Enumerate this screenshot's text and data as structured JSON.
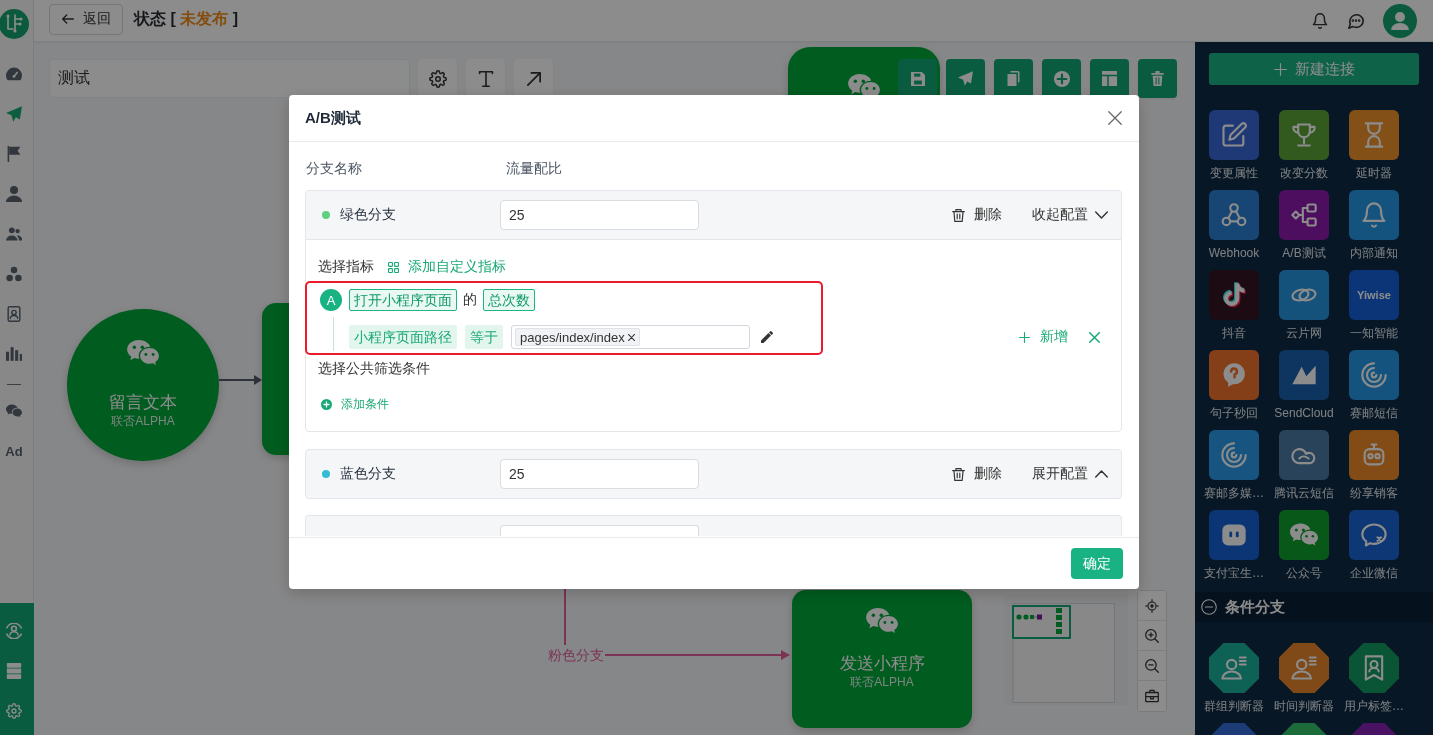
{
  "nav": {
    "main": [
      {
        "selected": false
      },
      {
        "selected": true
      },
      {
        "selected": false
      },
      {
        "selected": false
      },
      {
        "selected": false
      },
      {
        "selected": false
      },
      {
        "selected": false
      },
      {
        "selected": false
      }
    ],
    "extra": [
      {
        "kind": "icon",
        "selected": false
      },
      {
        "kind": "text",
        "label": "Ad",
        "selected": false
      }
    ]
  },
  "top_bar": {
    "back_button": "返回",
    "status": {
      "label": "状态",
      "open": "[",
      "value": "未发布",
      "close": "]"
    }
  },
  "canvas": {
    "flow_name": "测试",
    "nodes": [
      {
        "kind": "rect"
      },
      {
        "kind": "circle",
        "title": "留言文本",
        "subtitle": "联否ALPHA"
      },
      {
        "kind": "rect"
      },
      {
        "kind": "rect",
        "title": "发送小程序",
        "subtitle": "联否ALPHA"
      }
    ],
    "edges": [
      {
        "color": "#2e323b"
      },
      {
        "color": "#7b3555",
        "label": "粉色分支"
      }
    ]
  },
  "modal": {
    "title": "A/B测试",
    "columns": [
      "分支名称",
      "流量配比"
    ],
    "branches": [
      {
        "name": "绿色分支",
        "color": "#5fd07f",
        "ratio": "25",
        "delete_label": "删除",
        "toggle_label": "收起配置",
        "expanded": true,
        "metric_label": "选择指标",
        "add_metric": "添加自定义指标",
        "metric": {
          "highlighted": true,
          "badge": "A",
          "event": "打开小程序页面",
          "joiner": "的",
          "measure": "总次数",
          "filter": {
            "field": "小程序页面路径",
            "operator": "等于",
            "values": [
              "pages/index/index"
            ]
          },
          "add_label": "新增"
        },
        "filter_label": "选择公共筛选条件",
        "add_condition": "添加条件"
      },
      {
        "name": "蓝色分支",
        "color": "#35bcd4",
        "ratio": "25",
        "delete_label": "删除",
        "toggle_label": "展开配置",
        "expanded": false
      }
    ],
    "more_below": true,
    "confirm_button": "确定"
  },
  "panel": {
    "new_button": "新建连接",
    "rows": [
      [
        {
          "label": "变更属性",
          "color": "#203a76"
        },
        {
          "label": "改变分数",
          "color": "#325b20"
        },
        {
          "label": "延时器",
          "color": "#835118"
        }
      ],
      [
        {
          "label": "Webhook",
          "color": "#174674"
        },
        {
          "label": "A/B测试",
          "color": "#4e0f61"
        },
        {
          "label": "内部通知",
          "color": "#15537d"
        }
      ],
      [
        {
          "label": "抖音",
          "color": "#1c0b13"
        },
        {
          "label": "云片网",
          "color": "#15527b"
        },
        {
          "label": "一知智能",
          "color": "#0b3677",
          "logo_text": "Yiwise"
        }
      ],
      [
        {
          "label": "句子秒回",
          "color": "#843f18"
        },
        {
          "label": "SendCloud",
          "color": "#0d3661"
        },
        {
          "label": "赛邮短信",
          "color": "#15537d"
        }
      ],
      [
        {
          "label": "赛邮多媒…",
          "color": "#17547f"
        },
        {
          "label": "腾讯云短信",
          "color": "#29445b"
        },
        {
          "label": "纷享销客",
          "color": "#834c17"
        }
      ],
      [
        {
          "label": "支付宝生…",
          "color": "#0c3677"
        },
        {
          "label": "公众号",
          "color": "#09581a"
        },
        {
          "label": "企业微信",
          "color": "#0f3776"
        }
      ]
    ],
    "section": {
      "title": "条件分支",
      "expanded": true,
      "items": [
        {
          "label": "群组判断器",
          "color": "#0d6255"
        },
        {
          "label": "时间判断器",
          "color": "#804b18"
        },
        {
          "label": "用户标签…",
          "color": "#0a5536"
        },
        {
          "color": "#1c3c78"
        },
        {
          "color": "#1d6a3b"
        },
        {
          "color": "#4b1263"
        }
      ]
    }
  }
}
